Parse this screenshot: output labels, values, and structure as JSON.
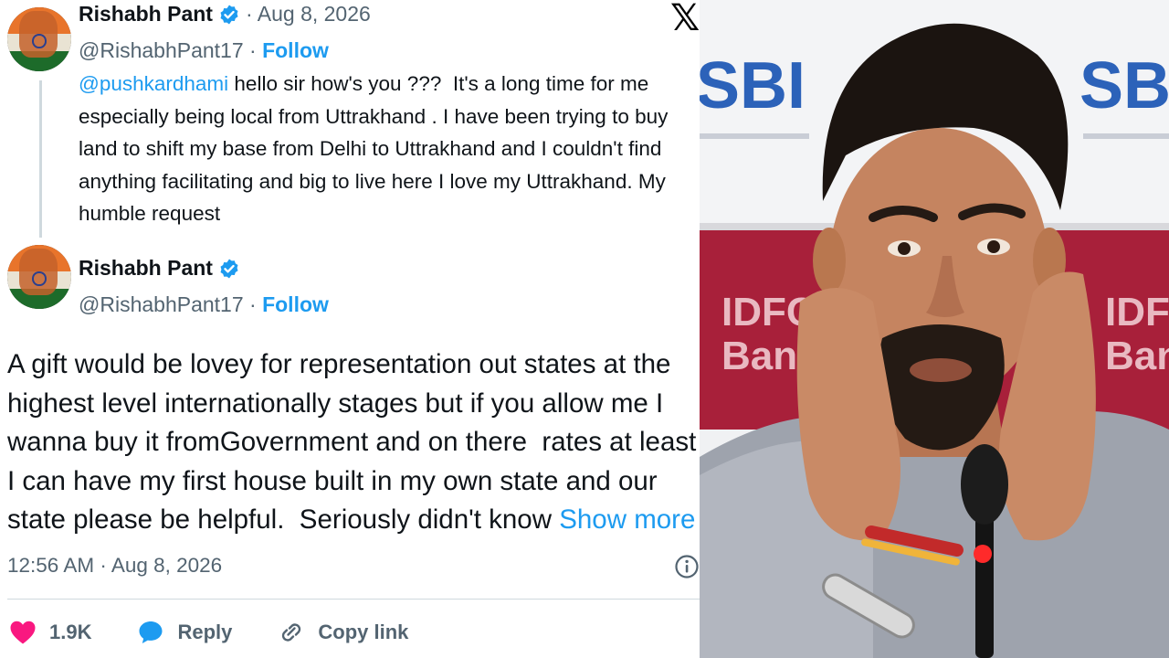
{
  "brand": {
    "x_logo": "𝕏"
  },
  "tweets": [
    {
      "author_name": "Rishabh Pant",
      "date": "· Aug 8, 2026",
      "handle": "@RishabhPant17 ·",
      "follow_label": "Follow",
      "mention": "@pushkardhami",
      "text": " hello sir how's you ???  It's a long time for me especially being local from Uttrakhand . I have been trying to buy land to shift my base from Delhi to Uttrakhand and I couldn't find anything facilitating and big to live here I love my Uttrakhand. My humble request"
    },
    {
      "author_name": "Rishabh Pant",
      "handle": "@RishabhPant17 ·",
      "follow_label": "Follow",
      "text": "A gift would be lovey for representation out states at the highest level internationally stages but if you allow me I wanna buy it fromGovernment and on there  rates at least I can have my first house built in my own state and our state please be helpful.  Seriously didn't know ",
      "show_more": "Show more",
      "timestamp": "12:56 AM · Aug 8, 2026"
    }
  ],
  "actions": {
    "like_count": "1.9K",
    "reply_label": "Reply",
    "copy_link_label": "Copy link"
  },
  "colors": {
    "accent": "#1d9bf0",
    "like": "#f91880",
    "secondary_text": "#536471",
    "text": "#0f1419"
  },
  "photo": {
    "sponsor_text_1": "SBI",
    "sponsor_text_2": "IDFC",
    "sponsor_text_3": "Bank"
  }
}
